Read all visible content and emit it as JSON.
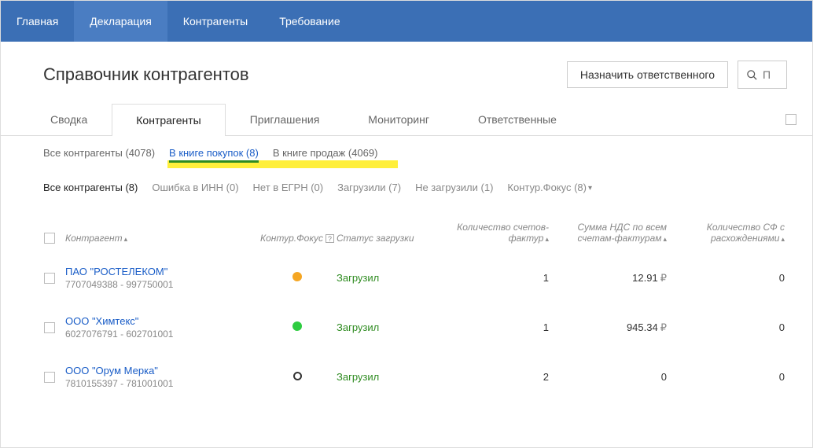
{
  "nav": {
    "items": [
      "Главная",
      "Декларация",
      "Контрагенты",
      "Требование"
    ]
  },
  "header": {
    "title": "Справочник контрагентов",
    "assign_btn": "Назначить ответственного",
    "search_placeholder": "П"
  },
  "tabs": {
    "items": [
      "Сводка",
      "Контрагенты",
      "Приглашения",
      "Мониторинг",
      "Ответственные"
    ]
  },
  "sub1": {
    "all": "Все контрагенты (4078)",
    "purchases": "В книге покупок (8)",
    "sales": "В книге продаж (4069)"
  },
  "sub2": {
    "all": "Все контрагенты (8)",
    "inn_err": "Ошибка в ИНН (0)",
    "no_egrn": "Нет в ЕГРН (0)",
    "loaded": "Загрузили (7)",
    "not_loaded": "Не загрузили (1)",
    "focus": "Контур.Фокус (8)"
  },
  "thead": {
    "name": "Контрагент",
    "focus": "Контур.Фокус",
    "status": "Статус загрузки",
    "count": "Количество счетов-фактур",
    "sum": "Сумма НДС по всем счетам-фактурам",
    "disc": "Количество СФ с расхождениями"
  },
  "rows": [
    {
      "name": "ПАО \"РОСТЕЛЕКОМ\"",
      "sub": "7707049388 - 997750001",
      "dot": "orange",
      "status": "Загрузил",
      "count": "1",
      "sum": "12.91",
      "disc": "0"
    },
    {
      "name": "ООО \"Химтекс\"",
      "sub": "6027076791 - 602701001",
      "dot": "green",
      "status": "Загрузил",
      "count": "1",
      "sum": "945.34",
      "disc": "0"
    },
    {
      "name": "ООО \"Орум Мерка\"",
      "sub": "7810155397 - 781001001",
      "dot": "hollow",
      "status": "Загрузил",
      "count": "2",
      "sum": "0",
      "disc": "0"
    }
  ]
}
